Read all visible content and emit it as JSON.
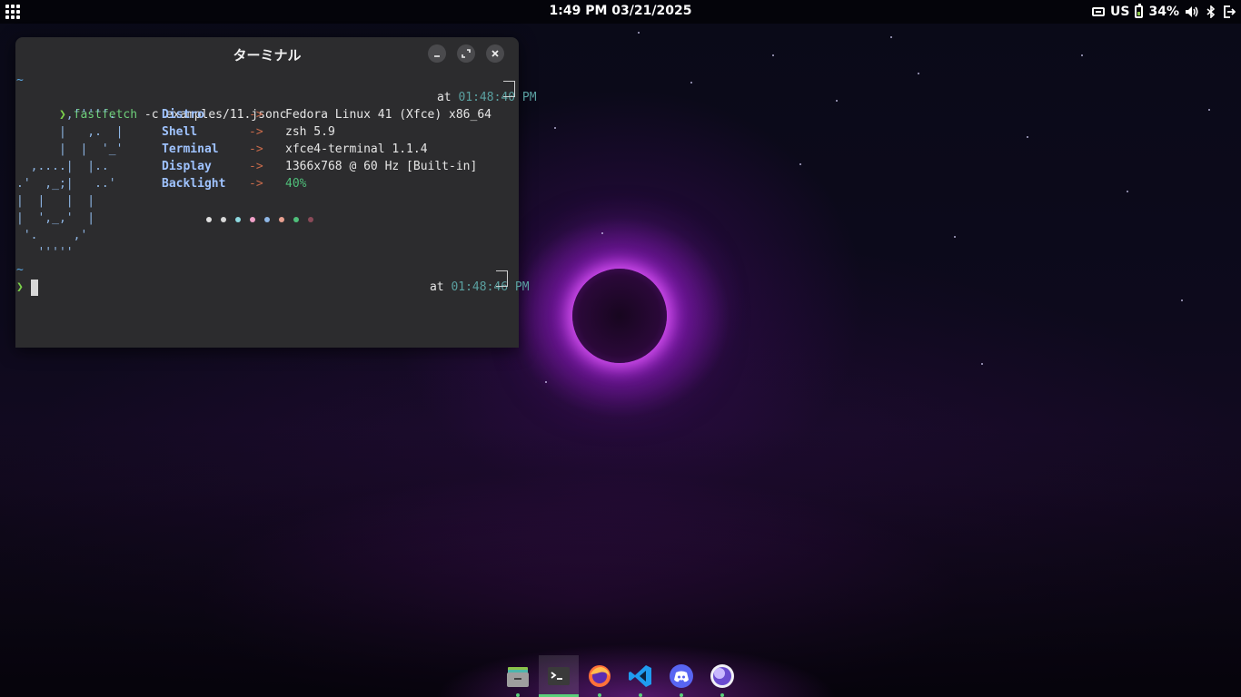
{
  "top_panel": {
    "clock": "1:49 PM   03/21/2025",
    "keyboard_layout": "US",
    "battery_percent": "34%",
    "battery_level": 0.34
  },
  "terminal": {
    "title": "ターミナル",
    "prompt1": {
      "tilde": "~",
      "arrow": "❯",
      "command": "fastfetch",
      "args": " -c examples/11.jsonc",
      "at_label": "at ",
      "time": "01:48:40 PM"
    },
    "logo_lines": [
      "       ,'''''.",
      "      |   ,.  |",
      "      |  |  '_'",
      "  ,....|  |..",
      ".'  ,_;|   ..'",
      "|  |   |  |",
      "|  ',_,'  |",
      " '.     ,'",
      "   '''''"
    ],
    "info": [
      {
        "key": "Distro",
        "sep": "->",
        "value": "Fedora Linux 41 (Xfce) x86_64"
      },
      {
        "key": "Shell",
        "sep": "->",
        "value": "zsh 5.9"
      },
      {
        "key": "Terminal",
        "sep": "->",
        "value": "xfce4-terminal 1.1.4"
      },
      {
        "key": "Display",
        "sep": "->",
        "value": "1366x768 @ 60 Hz [Built-in]"
      },
      {
        "key": "Backlight",
        "sep": "->",
        "value": "40%"
      }
    ],
    "color_dots": [
      "#e0e0e0",
      "#d8d8d8",
      "#8ed9e0",
      "#f0a0c8",
      "#8fb7e6",
      "#e8a090",
      "#4fbf7a",
      "#8a4a58"
    ],
    "prompt2": {
      "tilde": "~",
      "arrow": "❯",
      "at_label": "at ",
      "time": "01:48:46 PM"
    }
  },
  "dock": {
    "items": [
      "file-manager-icon",
      "terminal-icon",
      "firefox-icon",
      "vscode-icon",
      "discord-icon",
      "browser-orb-icon"
    ],
    "active": "terminal-icon"
  },
  "colors": {
    "accent_green": "#5ad07a",
    "terminal_bg": "#2c2c2e"
  }
}
